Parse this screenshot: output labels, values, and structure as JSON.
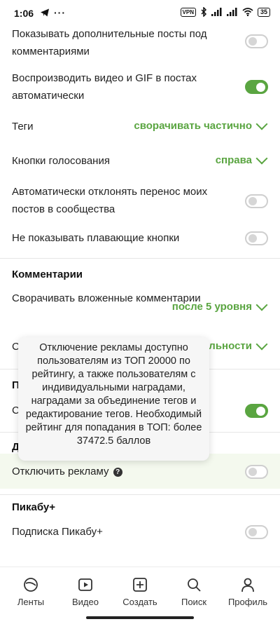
{
  "status_bar": {
    "time": "1:06",
    "vpn": "VPN",
    "battery": "35"
  },
  "settings": {
    "show_more_posts": {
      "label": "Показывать дополнительные посты под комментариями",
      "on": false
    },
    "autoplay": {
      "label": "Воспроизводить видео и GIF в постах автоматически",
      "on": true
    },
    "tags": {
      "label": "Теги",
      "value": "сворачивать частично"
    },
    "vote_buttons": {
      "label": "Кнопки голосования",
      "value": "справа"
    },
    "decline_transfer": {
      "label": "Автоматически отклонять перенос моих постов в сообщества",
      "on": false
    },
    "hide_floating": {
      "label": "Не показывать плавающие кнопки",
      "on": false
    }
  },
  "comments_section": {
    "title": "Комментарии",
    "collapse_nested": {
      "label": "Сворачивать вложенные комментарии",
      "value": "после 5 уровня"
    },
    "partial_label": "С",
    "partial_value": "альности"
  },
  "hidden_rows": {
    "section_letter": "П",
    "row_letter": "С",
    "row_on": true,
    "section2_letter": "Д"
  },
  "ads": {
    "label": "Отключить рекламу",
    "help": "?",
    "on": false
  },
  "pikabu_plus": {
    "title": "Пикабу+",
    "subscription_label": "Подписка Пикабу+",
    "on": false
  },
  "tooltip": {
    "text": "Отключение рекламы доступно пользователям из ТОП 20000 по рейтингу, а также пользователям с индивидуальными наградами, наградами за объединение тегов и редактирование тегов. Необходимый рейтинг для попадания в ТОП: более 37472.5 баллов"
  },
  "tabs": [
    {
      "label": "Ленты",
      "icon": "feeds-icon"
    },
    {
      "label": "Видео",
      "icon": "video-icon"
    },
    {
      "label": "Создать",
      "icon": "create-icon"
    },
    {
      "label": "Поиск",
      "icon": "search-icon"
    },
    {
      "label": "Профиль",
      "icon": "profile-icon"
    }
  ],
  "colors": {
    "accent": "#5aa541",
    "highlight_bg": "#f4f9ee"
  }
}
